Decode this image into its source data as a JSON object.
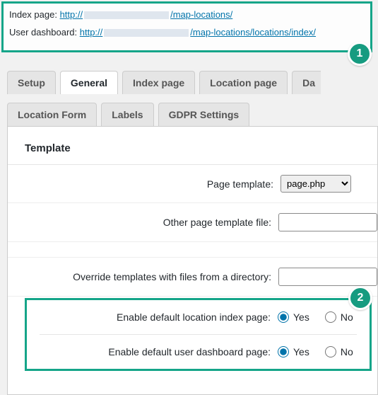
{
  "annotations": {
    "badge1": "1",
    "badge2": "2"
  },
  "links": {
    "index_label": "Index page:",
    "index_proto": "http://",
    "index_suffix": "/map-locations/",
    "dash_label": "User dashboard:",
    "dash_proto": "http://",
    "dash_suffix": "/map-locations/locations/index/"
  },
  "tabs": {
    "setup": "Setup",
    "general": "General",
    "index_page": "Index page",
    "location_page": "Location page",
    "data_cut": "Da",
    "location_form": "Location Form",
    "labels": "Labels",
    "gdpr": "GDPR Settings"
  },
  "section": {
    "title": "Template"
  },
  "fields": {
    "page_template_label": "Page template:",
    "page_template_value": "page.php",
    "other_template_label": "Other page template file:",
    "other_template_value": "",
    "override_label": "Override templates with files from a directory:",
    "override_value": "",
    "enable_index_label": "Enable default location index page:",
    "enable_dash_label": "Enable default user dashboard page:",
    "yes": "Yes",
    "no": "No"
  }
}
